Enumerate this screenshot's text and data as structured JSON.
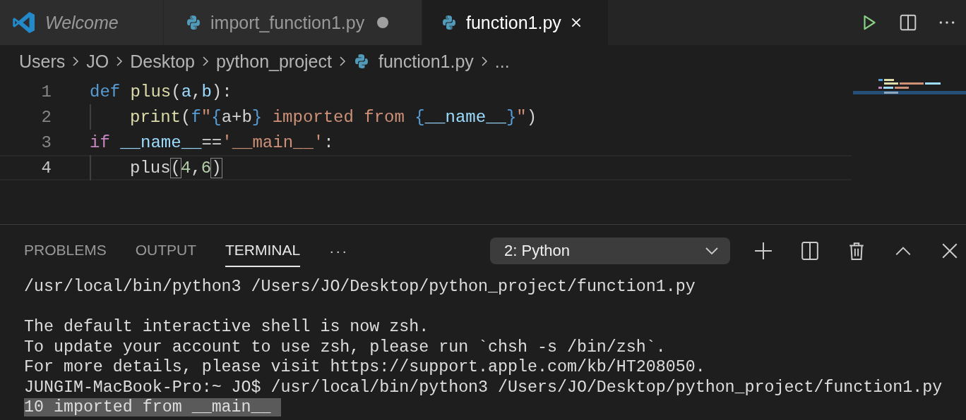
{
  "editor_tabs": [
    {
      "label": "Welcome",
      "kind": "welcome",
      "preview": true,
      "dirty": false,
      "selected": false
    },
    {
      "label": "import_function1.py",
      "kind": "file",
      "preview": false,
      "dirty": true,
      "selected": false
    },
    {
      "label": "function1.py",
      "kind": "file",
      "preview": false,
      "dirty": false,
      "selected": true
    }
  ],
  "breadcrumbs": [
    {
      "label": "Users",
      "kind": "folder"
    },
    {
      "label": "JO",
      "kind": "folder"
    },
    {
      "label": "Desktop",
      "kind": "folder"
    },
    {
      "label": "python_project",
      "kind": "folder"
    },
    {
      "label": "function1.py",
      "kind": "file"
    },
    {
      "label": "...",
      "kind": "folder"
    }
  ],
  "code_lines": [
    {
      "number": "1",
      "indent": false,
      "current": false,
      "tokens": [
        {
          "t": "def ",
          "kind": "keyword"
        },
        {
          "t": "plus",
          "kind": "function"
        },
        {
          "t": "(",
          "kind": "plain"
        },
        {
          "t": "a",
          "kind": "param"
        },
        {
          "t": ",",
          "kind": "plain"
        },
        {
          "t": "b",
          "kind": "param"
        },
        {
          "t": "):",
          "kind": "plain"
        }
      ]
    },
    {
      "number": "2",
      "indent": true,
      "current": false,
      "tokens": [
        {
          "t": "print",
          "kind": "function"
        },
        {
          "t": "(",
          "kind": "plain"
        },
        {
          "t": "f",
          "kind": "keyword"
        },
        {
          "t": "\"",
          "kind": "string"
        },
        {
          "t": "{",
          "kind": "keyword"
        },
        {
          "t": "a+b",
          "kind": "plain"
        },
        {
          "t": "}",
          "kind": "keyword"
        },
        {
          "t": " imported from ",
          "kind": "string"
        },
        {
          "t": "{",
          "kind": "keyword"
        },
        {
          "t": "__name__",
          "kind": "param"
        },
        {
          "t": "}",
          "kind": "keyword"
        },
        {
          "t": "\"",
          "kind": "string"
        },
        {
          "t": ")",
          "kind": "plain"
        }
      ]
    },
    {
      "number": "3",
      "indent": false,
      "current": false,
      "tokens": [
        {
          "t": "if ",
          "kind": "control"
        },
        {
          "t": "__name__",
          "kind": "param"
        },
        {
          "t": "==",
          "kind": "plain"
        },
        {
          "t": "'__main__'",
          "kind": "string"
        },
        {
          "t": ":",
          "kind": "plain"
        }
      ]
    },
    {
      "number": "4",
      "indent": true,
      "current": true,
      "tokens": [
        {
          "t": "plus",
          "kind": "plain"
        },
        {
          "t": "(",
          "kind": "bracket"
        },
        {
          "t": "4",
          "kind": "number"
        },
        {
          "t": ",",
          "kind": "plain"
        },
        {
          "t": "6",
          "kind": "number"
        },
        {
          "t": ")",
          "kind": "bracket"
        }
      ]
    }
  ],
  "panel_tabs": [
    {
      "label": "PROBLEMS",
      "selected": false
    },
    {
      "label": "OUTPUT",
      "selected": false
    },
    {
      "label": "TERMINAL",
      "selected": true
    }
  ],
  "panel_more": "···",
  "terminal_select": {
    "value": "2: Python"
  },
  "terminal_lines": [
    {
      "kind": "output",
      "text": "/usr/local/bin/python3 /Users/JO/Desktop/python_project/function1.py",
      "highlighted": false
    },
    {
      "kind": "blank"
    },
    {
      "kind": "output",
      "text": "The default interactive shell is now zsh.",
      "highlighted": false
    },
    {
      "kind": "output",
      "text": "To update your account to use zsh, please run `chsh -s /bin/zsh`.",
      "highlighted": false
    },
    {
      "kind": "output",
      "text": "For more details, please visit https://support.apple.com/kb/HT208050.",
      "highlighted": false
    },
    {
      "kind": "output",
      "text": "JUNGIM-MacBook-Pro:~ JO$ /usr/local/bin/python3 /Users/JO/Desktop/python_project/function1.py",
      "highlighted": false
    },
    {
      "kind": "output",
      "text": "10 imported from __main__ ",
      "highlighted": true
    }
  ]
}
